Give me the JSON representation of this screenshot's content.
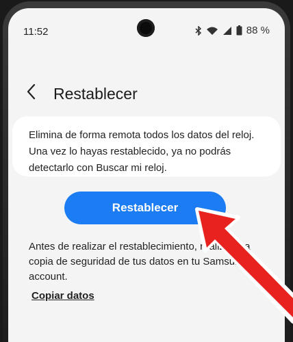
{
  "status_bar": {
    "time": "11:52",
    "battery": "88 %"
  },
  "header": {
    "title": "Restablecer"
  },
  "card": {
    "text": "Elimina de forma remota todos los datos del reloj. Una vez lo hayas restablecido, ya no podrás detectarlo con Buscar mi reloj."
  },
  "reset_button": {
    "label": "Restablecer",
    "color": "#1c7cf3"
  },
  "note": {
    "text": "Antes de realizar el restablecimiento, realiza una copia de seguridad de tus datos en tu Samsung account."
  },
  "copy_link": {
    "label": "Copiar datos"
  },
  "arrow": {
    "color": "#e8231f"
  }
}
